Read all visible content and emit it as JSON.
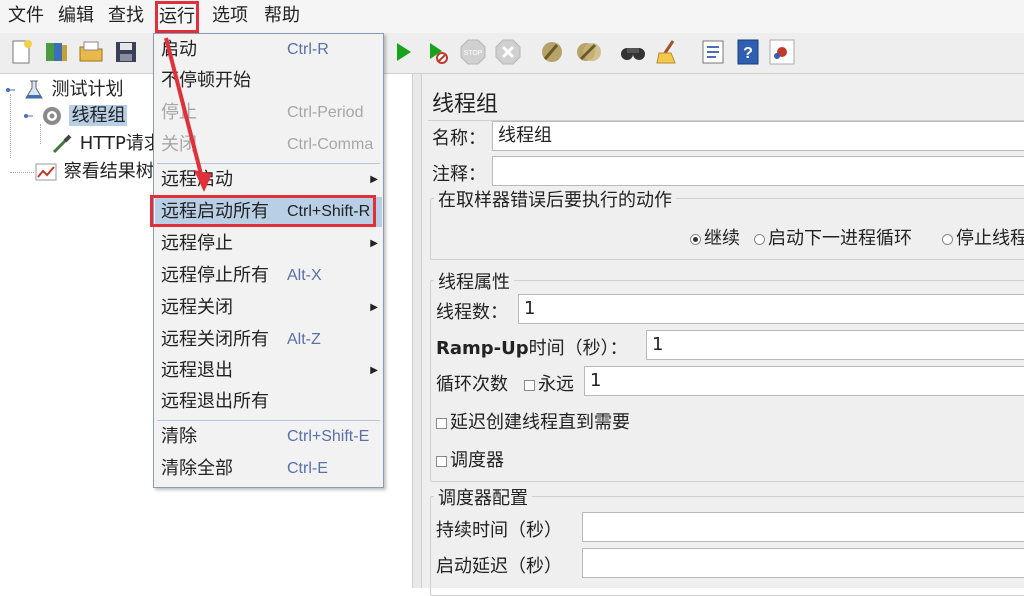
{
  "menubar": {
    "items": [
      {
        "label": "文件"
      },
      {
        "label": "编辑"
      },
      {
        "label": "查找"
      },
      {
        "label": "运行"
      },
      {
        "label": "选项"
      },
      {
        "label": "帮助"
      }
    ]
  },
  "toolbar": {
    "icons": [
      "new-icon",
      "templates-icon",
      "open-icon",
      "save-icon",
      "start-icon",
      "start-no-timers-icon",
      "stop-icon",
      "shutdown-icon",
      "clear-icon",
      "clear-all-icon",
      "search-icon",
      "reset-search-icon",
      "function-helper-icon",
      "help-icon",
      "remote-icon"
    ],
    "stop_text": "STOP"
  },
  "tree": {
    "nodes": [
      {
        "label": "测试计划"
      },
      {
        "label": "线程组"
      },
      {
        "label": "HTTP请求"
      },
      {
        "label": "察看结果树"
      }
    ]
  },
  "run_menu": {
    "items": [
      {
        "label": "启动",
        "shortcut": "Ctrl-R"
      },
      {
        "label": "不停顿开始",
        "shortcut": ""
      },
      {
        "label": "停止",
        "shortcut": "Ctrl-Period"
      },
      {
        "label": "关闭",
        "shortcut": "Ctrl-Comma"
      },
      {
        "label": "远程启动",
        "shortcut": ""
      },
      {
        "label": "远程启动所有",
        "shortcut": "Ctrl+Shift-R"
      },
      {
        "label": "远程停止",
        "shortcut": ""
      },
      {
        "label": "远程停止所有",
        "shortcut": "Alt-X"
      },
      {
        "label": "远程关闭",
        "shortcut": ""
      },
      {
        "label": "远程关闭所有",
        "shortcut": "Alt-Z"
      },
      {
        "label": "远程退出",
        "shortcut": ""
      },
      {
        "label": "远程退出所有",
        "shortcut": ""
      },
      {
        "label": "清除",
        "shortcut": "Ctrl+Shift-E"
      },
      {
        "label": "清除全部",
        "shortcut": "Ctrl-E"
      }
    ]
  },
  "panel": {
    "title": "线程组",
    "name_label": "名称：",
    "name_value": "线程组",
    "comment_label": "注释：",
    "comment_value": "",
    "error_group_title": "在取样器错误后要执行的动作",
    "error_options": [
      "继续",
      "启动下一进程循环",
      "停止线程"
    ],
    "props_group_title": "线程属性",
    "threads_label": "线程数：",
    "threads_value": "1",
    "rampup_label_bold": "Ramp-Up",
    "rampup_label_rest": "时间（秒）：",
    "rampup_value": "1",
    "loop_label": "循环次数",
    "forever_label": "永远",
    "loop_value": "1",
    "delay_label": "延迟创建线程直到需要",
    "scheduler_label": "调度器",
    "sched_group_title": "调度器配置",
    "duration_label": "持续时间（秒）",
    "duration_value": "",
    "startup_delay_label": "启动延迟（秒）",
    "startup_delay_value": ""
  },
  "colors": {
    "annotation_red": "#e0303a",
    "selection_blue": "#b8cfe5",
    "shortcut_blue": "#5b6fa8"
  }
}
